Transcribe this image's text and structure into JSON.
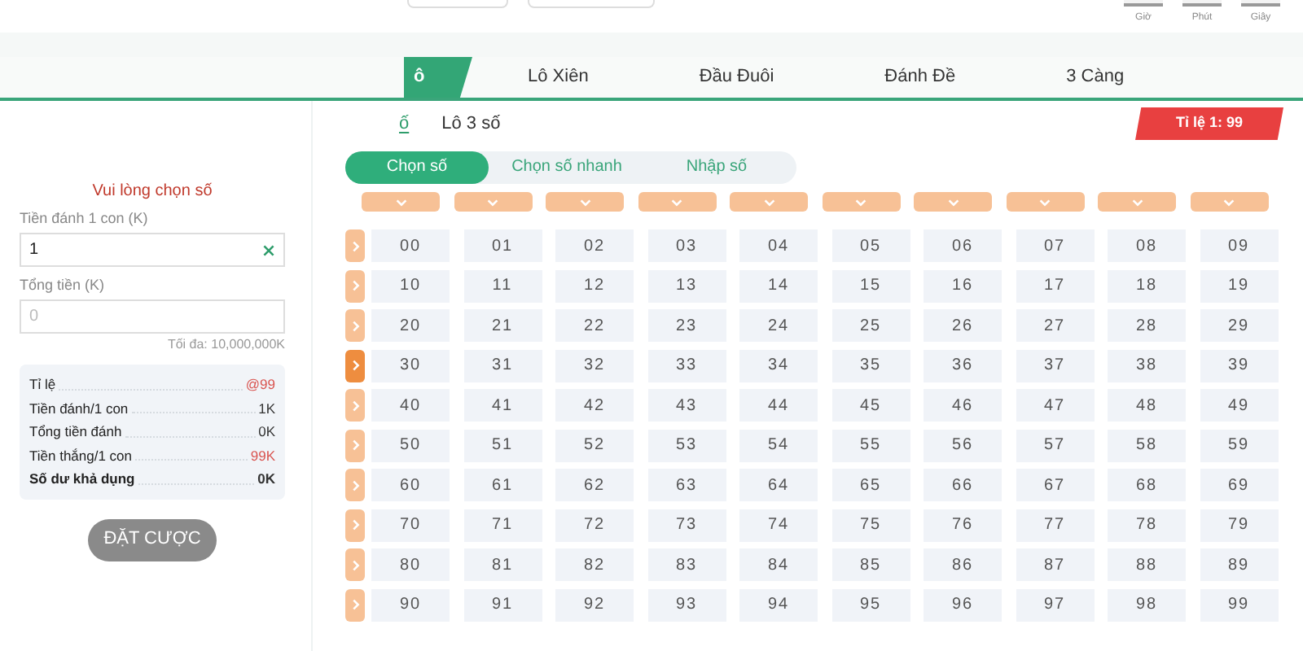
{
  "timer": {
    "labels": [
      "Giờ",
      "Phút",
      "Giây"
    ]
  },
  "tabs": [
    {
      "label": "ô",
      "selected": true
    },
    {
      "label": "Lô Xiên",
      "selected": false
    },
    {
      "label": "Đầu Đuôi",
      "selected": false
    },
    {
      "label": "Đánh Đề",
      "selected": false
    },
    {
      "label": "3 Càng",
      "selected": false
    }
  ],
  "sub_tabs": [
    {
      "label": "ố",
      "selected": true
    },
    {
      "label": "Lô 3 số",
      "selected": false
    }
  ],
  "odds_badge": "Tỉ lệ 1: 99",
  "mode_tabs": [
    {
      "label": "Chọn số",
      "selected": true
    },
    {
      "label": "Chọn số nhanh",
      "selected": false
    },
    {
      "label": "Nhập số",
      "selected": false
    }
  ],
  "bet_panel": {
    "message": "Vui lòng chọn số",
    "amount_label": "Tiền đánh 1 con (K)",
    "amount_value": "1",
    "total_label": "Tổng tiền (K)",
    "total_placeholder": "0",
    "max_note": "Tối đa: 10,000,000K",
    "summary": [
      {
        "label": "Tỉ lệ",
        "value": "@99",
        "color": "#d9534f",
        "bold": false
      },
      {
        "label": "Tiền đánh/1 con",
        "value": "1K",
        "color": "#333333",
        "bold": false
      },
      {
        "label": "Tổng tiền đánh",
        "value": "0K",
        "color": "#333333",
        "bold": false
      },
      {
        "label": "Tiền thắng/1 con",
        "value": "99K",
        "color": "#d9534f",
        "bold": false
      },
      {
        "label": "Số dư khả dụng",
        "value": "0K",
        "color": "#333333",
        "bold": true
      }
    ],
    "submit": {
      "label": "ĐẶT CƯỢC",
      "disabled": true
    }
  },
  "grid": {
    "rows": [
      {
        "selected": false,
        "numbers": [
          "00",
          "01",
          "02",
          "03",
          "04",
          "05",
          "06",
          "07",
          "08",
          "09"
        ]
      },
      {
        "selected": false,
        "numbers": [
          "10",
          "11",
          "12",
          "13",
          "14",
          "15",
          "16",
          "17",
          "18",
          "19"
        ]
      },
      {
        "selected": false,
        "numbers": [
          "20",
          "21",
          "22",
          "23",
          "24",
          "25",
          "26",
          "27",
          "28",
          "29"
        ]
      },
      {
        "selected": true,
        "numbers": [
          "30",
          "31",
          "32",
          "33",
          "34",
          "35",
          "36",
          "37",
          "38",
          "39"
        ]
      },
      {
        "selected": false,
        "numbers": [
          "40",
          "41",
          "42",
          "43",
          "44",
          "45",
          "46",
          "47",
          "48",
          "49"
        ]
      },
      {
        "selected": false,
        "numbers": [
          "50",
          "51",
          "52",
          "53",
          "54",
          "55",
          "56",
          "57",
          "58",
          "59"
        ]
      },
      {
        "selected": false,
        "numbers": [
          "60",
          "61",
          "62",
          "63",
          "64",
          "65",
          "66",
          "67",
          "68",
          "69"
        ]
      },
      {
        "selected": false,
        "numbers": [
          "70",
          "71",
          "72",
          "73",
          "74",
          "75",
          "76",
          "77",
          "78",
          "79"
        ]
      },
      {
        "selected": false,
        "numbers": [
          "80",
          "81",
          "82",
          "83",
          "84",
          "85",
          "86",
          "87",
          "88",
          "89"
        ]
      },
      {
        "selected": false,
        "numbers": [
          "90",
          "91",
          "92",
          "93",
          "94",
          "95",
          "96",
          "97",
          "98",
          "99"
        ]
      }
    ]
  }
}
